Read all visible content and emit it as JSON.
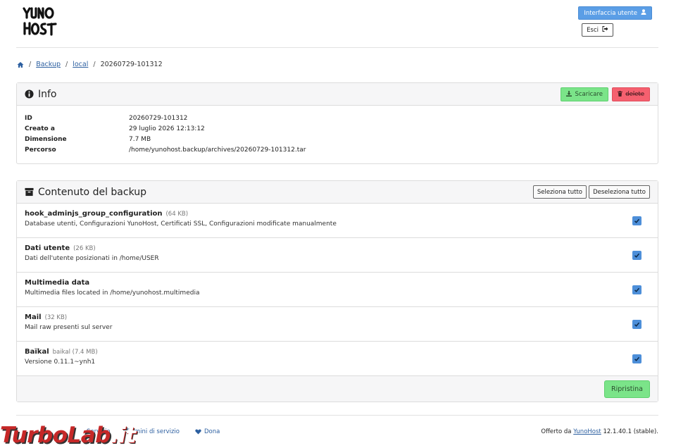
{
  "header": {
    "logo_text": "YUNO HOST",
    "user_interface_label": "Interfaccia utente",
    "logout_label": "Esci"
  },
  "breadcrumb": {
    "items": [
      "Backup",
      "local",
      "20260729-101312"
    ]
  },
  "info": {
    "title": "Info",
    "download_label": "Scaricare",
    "delete_label": "delete",
    "rows": [
      {
        "key": "ID",
        "value": "20260729-101312"
      },
      {
        "key": "Creato a",
        "value": "29 luglio 2026 12:13:12"
      },
      {
        "key": "Dimensione",
        "value": "7.7 MB"
      },
      {
        "key": "Percorso",
        "value": "/home/yunohost.backup/archives/20260729-101312.tar"
      }
    ]
  },
  "content": {
    "title": "Contenuto del backup",
    "select_all_label": "Seleziona tutto",
    "deselect_all_label": "Deseleziona tutto",
    "restore_label": "Ripristina",
    "items": [
      {
        "name": "hook_adminjs_group_configuration",
        "size": "(64 KB)",
        "description": "Database utenti, Configurazioni YunoHost, Certificati SSL, Configurazioni modificate manualmente",
        "checked": true
      },
      {
        "name": "Dati utente",
        "size": "(26 KB)",
        "description": "Dati dell'utente posizionati in /home/USER",
        "checked": true
      },
      {
        "name": "Multimedia data",
        "size": "",
        "description": "Multimedia files located in /home/yunohost.multimedia",
        "checked": true
      },
      {
        "name": "Mail",
        "size": "(32 KB)",
        "description": "Mail raw presenti sul server",
        "checked": true
      },
      {
        "name": "Baïkal",
        "size": "baikal (7.4 MB)",
        "description": "Versione 0.11.1~ynh1",
        "checked": true
      }
    ]
  },
  "footer": {
    "links": [
      "Servizio",
      "Termini di servizio",
      "Dona"
    ],
    "offered_by": "Offerto da",
    "brand": "YunoHost",
    "version": "12.1.40.1 (stable)."
  },
  "watermark": {
    "text_main": "TurboLab",
    "text_suffix": ".it"
  },
  "colors": {
    "primary": "#5b9ee6",
    "success": "#7be489",
    "danger": "#f5606f",
    "checkbox": "#4d8fd9",
    "link": "#2c5fa0"
  }
}
